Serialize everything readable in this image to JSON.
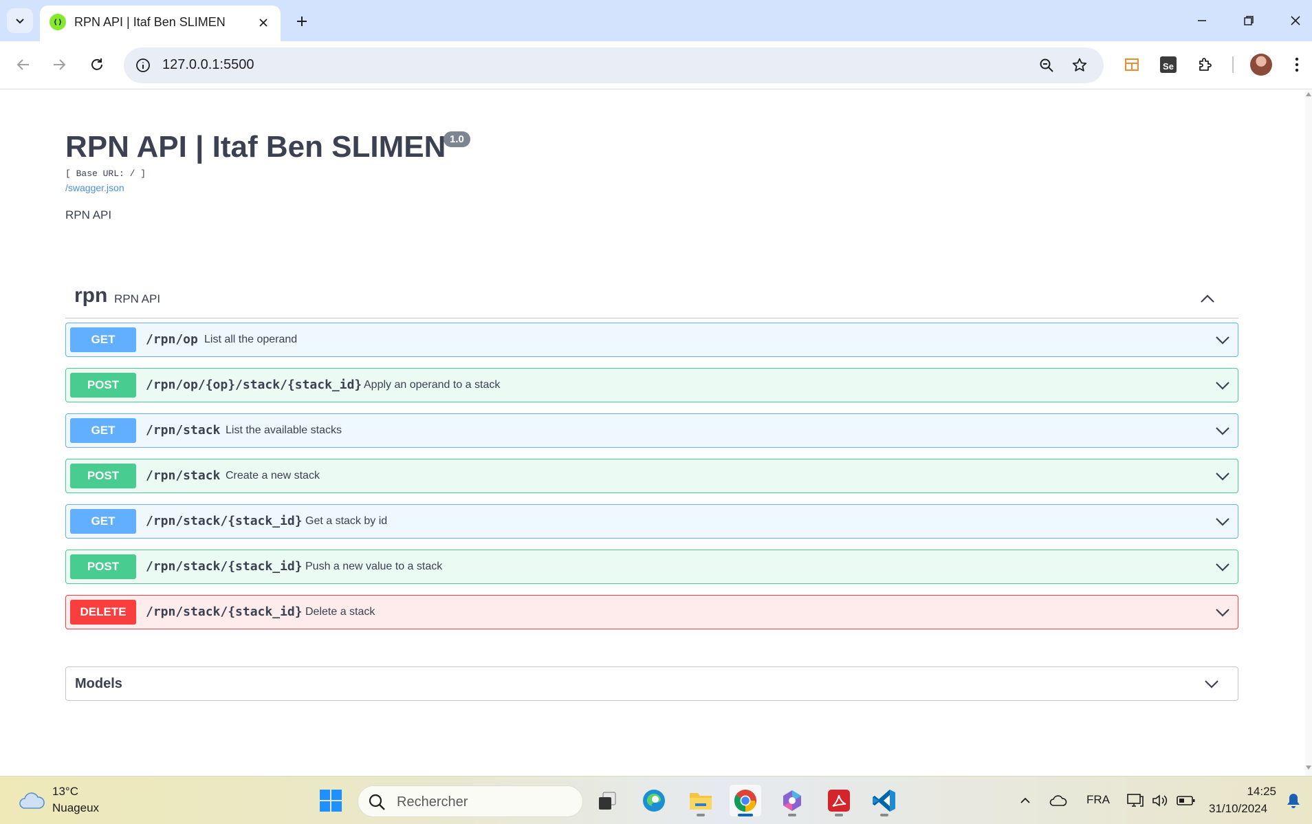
{
  "browser": {
    "tab_title": "RPN API | Itaf Ben SLIMEN",
    "url": "127.0.0.1:5500"
  },
  "swagger": {
    "title": "RPN API | Itaf Ben SLIMEN",
    "version": "1.0",
    "base_url": "[ Base URL: / ]",
    "spec_link": "/swagger.json",
    "description": "RPN API",
    "tag": {
      "name": "rpn",
      "description": "RPN API"
    },
    "operations": [
      {
        "method": "GET",
        "path": "/rpn/op",
        "summary": "List all the operand"
      },
      {
        "method": "POST",
        "path": "/rpn/op/{op}/stack/{stack_id}",
        "summary": "Apply an operand to a stack"
      },
      {
        "method": "GET",
        "path": "/rpn/stack",
        "summary": "List the available stacks"
      },
      {
        "method": "POST",
        "path": "/rpn/stack",
        "summary": "Create a new stack"
      },
      {
        "method": "GET",
        "path": "/rpn/stack/{stack_id}",
        "summary": "Get a stack by id"
      },
      {
        "method": "POST",
        "path": "/rpn/stack/{stack_id}",
        "summary": "Push a new value to a stack"
      },
      {
        "method": "DELETE",
        "path": "/rpn/stack/{stack_id}",
        "summary": "Delete a stack"
      }
    ],
    "models_label": "Models",
    "colors": {
      "get": "#61affe",
      "post": "#49cc90",
      "delete": "#f93e3e"
    }
  },
  "taskbar": {
    "weather_temp": "13°C",
    "weather_condition": "Nuageux",
    "search_placeholder": "Rechercher",
    "language": "FRA",
    "time": "14:25",
    "date": "31/10/2024"
  }
}
